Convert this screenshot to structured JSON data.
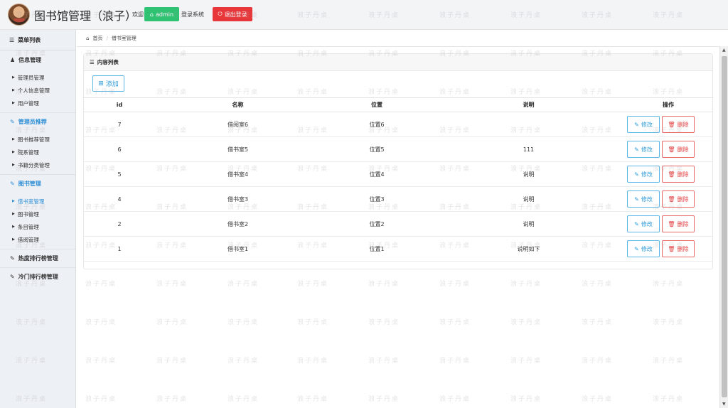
{
  "header": {
    "title": "图书馆管理（浪子）",
    "welcome": "欢迎",
    "user": "admin",
    "login_system": "登录系统",
    "logout": "退出登录"
  },
  "sidebar": {
    "menu_title": "菜单列表",
    "groups": [
      {
        "title": "信息管理",
        "icon": "user-icon",
        "items": [
          "管理员管理",
          "个人信息管理",
          "用户管理"
        ]
      },
      {
        "title": "管理员推荐",
        "icon": "edit-icon",
        "items": [
          "图书推荐管理",
          "院系管理",
          "书籍分类管理"
        ]
      },
      {
        "title": "图书管理",
        "icon": "edit-icon",
        "items": [
          "借书室管理",
          "图书管理",
          "条目管理",
          "借阅管理"
        ]
      },
      {
        "title": "热度排行榜管理",
        "icon": "edit-icon",
        "items": []
      },
      {
        "title": "冷门排行榜管理",
        "icon": "edit-icon",
        "items": []
      }
    ]
  },
  "breadcrumb": {
    "home": "首页",
    "current": "借书室管理"
  },
  "panel": {
    "title": "内容列表",
    "add_label": "添加"
  },
  "table": {
    "headers": [
      "id",
      "名称",
      "位置",
      "说明",
      "操作"
    ],
    "rows": [
      {
        "id": "7",
        "name": "借阅室6",
        "position": "位置6",
        "desc": ""
      },
      {
        "id": "6",
        "name": "借书室5",
        "position": "位置5",
        "desc": "111"
      },
      {
        "id": "5",
        "name": "借书室4",
        "position": "位置4",
        "desc": "说明"
      },
      {
        "id": "4",
        "name": "借书室3",
        "position": "位置3",
        "desc": "说明"
      },
      {
        "id": "2",
        "name": "借书室2",
        "position": "位置2",
        "desc": "说明"
      },
      {
        "id": "1",
        "name": "借书室1",
        "position": "位置1",
        "desc": "说明如下"
      }
    ],
    "edit_label": "修改",
    "delete_label": "删除"
  },
  "watermark": "浪子丹桌",
  "colors": {
    "accent": "#2f9bd8",
    "success": "#2ec272",
    "danger": "#e8373a",
    "active_menu": "#2f8fd6"
  }
}
